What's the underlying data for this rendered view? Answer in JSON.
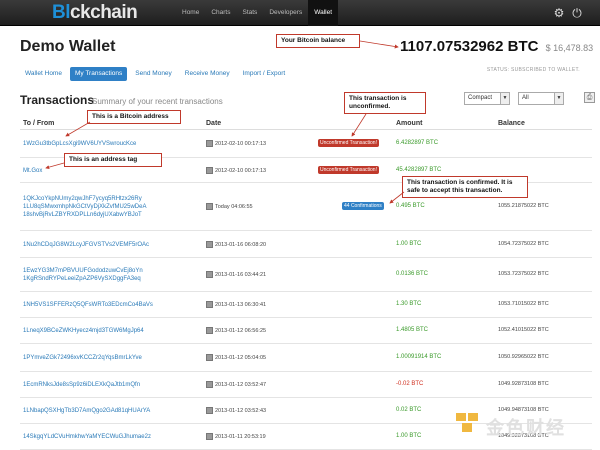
{
  "app": {
    "logo_b": "Bl",
    "logo_c": "ckchain",
    "nav": [
      "Home",
      "Charts",
      "Stats",
      "Developers",
      "Wallet"
    ]
  },
  "wallet": {
    "title": "Demo Wallet",
    "balance_btc": "1107.07532962 BTC",
    "balance_fiat": "$ 16,478.83",
    "status": "STATUS: SUBSCRIBED TO WALLET."
  },
  "subtabs": [
    "Wallet Home",
    "My Transactions",
    "Send Money",
    "Receive Money",
    "Import / Export"
  ],
  "section": {
    "title": "Transactions",
    "subtitle": "Summary of your recent transactions",
    "view_select": "Compact",
    "filter_select": "All"
  },
  "table": {
    "headers": [
      "To / From",
      "Date",
      "Amount",
      "Balance"
    ],
    "rows": [
      {
        "addr": "1WzGu3tbGpLcsXgi9WV6UYVSwroucKce",
        "date": "2012-02-10 00:17:13",
        "badge": "Unconfirmed Transaction!",
        "amount": "6.4282897 BTC",
        "sign": "pos",
        "balance": ""
      },
      {
        "addr": "Mt.Gox",
        "date": "2012-02-10 00:17:13",
        "badge": "Unconfirmed Transaction!",
        "amount": "45.4282897 BTC",
        "sign": "pos",
        "balance": ""
      },
      {
        "addr": "1QKJcoYkpNUmy2qwJhF7ycyq5RHtzx26Ry 1LU8qSMwxmhpNkGCtVyDjXkZvfMU25wDeA 18shvBjRvLZBYRXDPLLn6dyjUXabwYBJoT",
        "date": "Today 04:06:55",
        "badge": "44 Confirmations",
        "amount": "0.495 BTC",
        "sign": "pos",
        "balance": "1055.21875022 BTC"
      },
      {
        "addr": "1Nu2hCDqJG8W2LcyJFGVSTVs2VEMF5rOAc",
        "date": "2013-01-16 06:08:20",
        "badge": "",
        "amount": "1.00 BTC",
        "sign": "pos",
        "balance": "1054.72375022 BTC"
      },
      {
        "addr": "1EwzYG3M7mPBVUUFGododzuwCvEj8oYn 1KgRSndRYPeLeeiZpAZP6VySXDggFA3eq",
        "date": "2013-01-16 03:44:21",
        "badge": "",
        "amount": "0.0136 BTC",
        "sign": "pos",
        "balance": "1053.72375022 BTC"
      },
      {
        "addr": "1NH5VS1SFFERzQ5QFsWRTo3EDcmCo4BaVs",
        "date": "2013-01-13 06:30:41",
        "badge": "",
        "amount": "1.30 BTC",
        "sign": "pos",
        "balance": "1053.71015022 BTC"
      },
      {
        "addr": "1LneqX9BCeZWKHyecz4mjd3TGW6MgJp64",
        "date": "2013-01-12 06:56:25",
        "badge": "",
        "amount": "1.4805 BTC",
        "sign": "pos",
        "balance": "1052.41015022 BTC"
      },
      {
        "addr": "1PYmveZGk72496xvKCCZr2qYqsBmrLkYve",
        "date": "2013-01-12 05:04:05",
        "badge": "",
        "amount": "1.00091914 BTC",
        "sign": "pos",
        "balance": "1050.92965022 BTC"
      },
      {
        "addr": "1EcmRNksJde8sSp9z6iDLEXkQaJtb1mQfn",
        "date": "2013-01-12 03:52:47",
        "badge": "",
        "amount": "-0.02 BTC",
        "sign": "neg",
        "balance": "1049.92873108 BTC"
      },
      {
        "addr": "1LNbapQSXHgTb3D7AmQgo2GAd81qHUArYA",
        "date": "2013-01-12 03:52:43",
        "badge": "",
        "amount": "0.02 BTC",
        "sign": "pos",
        "balance": "1049.94873108 BTC"
      },
      {
        "addr": "14SkgqYLdCVuHmkhwYaMYECWuGJhumae2z",
        "date": "2013-01-11 20:53:19",
        "badge": "",
        "amount": "1.00 BTC",
        "sign": "pos",
        "balance": "1049.92873108 BTC"
      }
    ]
  },
  "callouts": {
    "balance": "Your Bitcoin balance",
    "address": "This is a Bitcoin address",
    "tag": "This is an address tag",
    "unconfirmed": "This transaction is unconfirmed.",
    "confirmed": "This transaction is confirmed. It is safe to accept this transaction."
  },
  "watermark": "金色财经",
  "icons": [
    "settings-icon",
    "power-icon",
    "calendar-icon",
    "print-icon"
  ],
  "colors": {
    "brand": "#1e90d8",
    "positive": "#3a9a2a",
    "negative": "#d03020",
    "badge_red": "#c0392b",
    "badge_blue": "#2f80c6"
  }
}
